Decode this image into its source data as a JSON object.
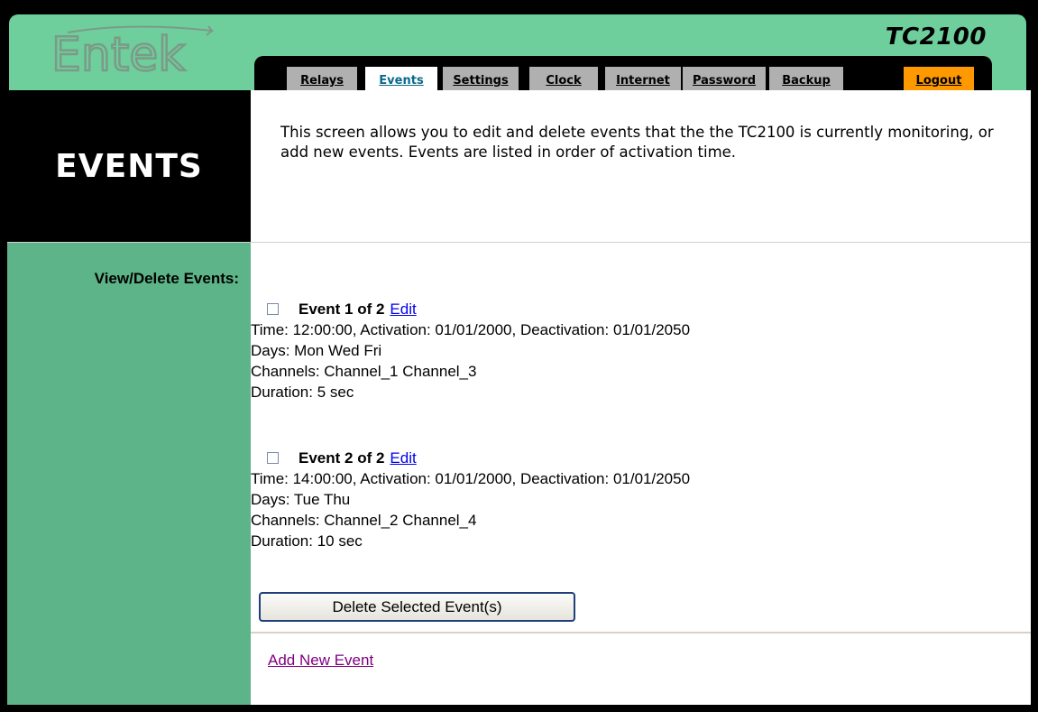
{
  "header": {
    "logo_text": "Entek",
    "product_name": "TC2100"
  },
  "nav": {
    "tabs": [
      {
        "label": "Relays"
      },
      {
        "label": "Events"
      },
      {
        "label": "Settings"
      },
      {
        "label": "Clock"
      },
      {
        "label": "Internet"
      },
      {
        "label": "Password"
      },
      {
        "label": "Backup"
      }
    ],
    "active_tab": "Events",
    "logout_label": "Logout"
  },
  "page": {
    "title": "EVENTS",
    "description": "This screen allows you to edit and delete events that the the TC2100 is currently monitoring, or add new events. Events are listed in order of activation time."
  },
  "section": {
    "label": "View/Delete Events:"
  },
  "events": [
    {
      "title": "Event 1 of 2",
      "edit_label": "Edit",
      "time_line": "Time: 12:00:00, Activation: 01/01/2000, Deactivation: 01/01/2050",
      "days_line": "Days: Mon Wed Fri",
      "channels_line": "Channels: Channel_1 Channel_3",
      "duration_line": "Duration: 5 sec",
      "checked": false
    },
    {
      "title": "Event 2 of 2",
      "edit_label": "Edit",
      "time_line": "Time: 14:00:00, Activation: 01/01/2000, Deactivation: 01/01/2050",
      "days_line": "Days: Tue Thu",
      "channels_line": "Channels: Channel_2 Channel_4",
      "duration_line": "Duration: 10 sec",
      "checked": false
    }
  ],
  "actions": {
    "delete_label": "Delete Selected Event(s)",
    "add_label": "Add New Event"
  },
  "colors": {
    "header_green": "#6ecf9c",
    "side_green": "#5cb488",
    "tab_grey": "#b0b0b0",
    "logout_orange": "#ff9900",
    "active_tab_text": "#0a6a8a"
  }
}
